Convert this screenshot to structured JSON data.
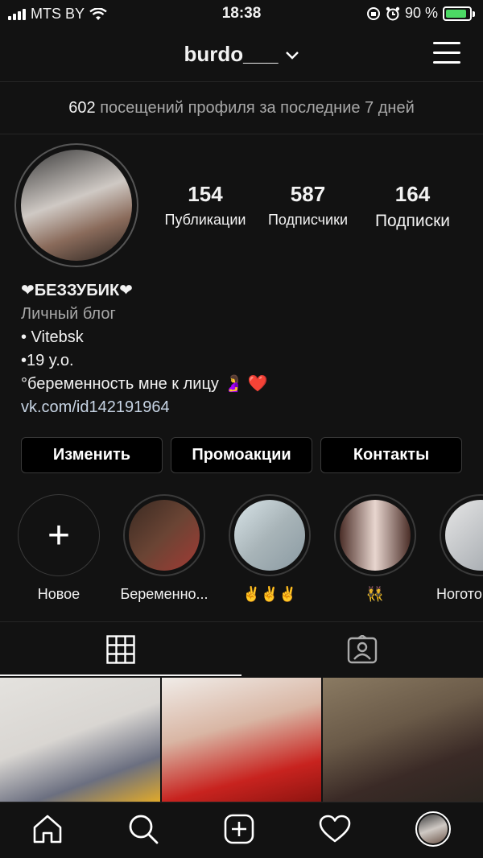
{
  "status_bar": {
    "carrier": "MTS BY",
    "time": "18:38",
    "battery_percent": "90 %",
    "battery_level": 0.9
  },
  "header": {
    "username": "burdo___"
  },
  "visits": {
    "count": "602",
    "text": "посещений профиля за последние 7 дней"
  },
  "stats": [
    {
      "value": "154",
      "label": "Публикации"
    },
    {
      "value": "587",
      "label": "Подписчики"
    },
    {
      "value": "164",
      "label": "Подписки"
    }
  ],
  "bio": {
    "name": "❤БЕЗЗУБИК❤",
    "category": "Личный блог",
    "line1": "• Vitebsk",
    "line2": "•19 y.o.",
    "line3": "°беременность мне к лицу 🤰 ❤️",
    "link": "vk.com/id142191964"
  },
  "buttons": {
    "edit": "Изменить",
    "promo": "Промоакции",
    "contacts": "Контакты"
  },
  "highlights": [
    {
      "label": "Новое",
      "icon": "plus-icon"
    },
    {
      "label": "Беременно...",
      "colors": [
        "#3a2a22",
        "#a23a34"
      ]
    },
    {
      "label": "✌️✌️✌️",
      "colors": [
        "#d8e4e8",
        "#8a9aa2"
      ]
    },
    {
      "label": "👯",
      "colors": [
        "#e8d6cf",
        "#4b2e28"
      ]
    },
    {
      "label": "Ногото",
      "colors": [
        "#e6e6e6",
        "#9aa0a6"
      ]
    }
  ],
  "tabs": {
    "grid_icon": "grid-icon",
    "tagged_icon": "tagged-person-icon"
  },
  "grid_posts": [
    {
      "colors": [
        "#d9d6d2",
        "#6b6f80"
      ]
    },
    {
      "colors": [
        "#e9e4e0",
        "#c8231f"
      ]
    },
    {
      "colors": [
        "#6a5a48",
        "#2b2520"
      ]
    }
  ],
  "bottom_nav": [
    "home-icon",
    "search-icon",
    "new-post-icon",
    "activity-heart-icon",
    "profile-avatar"
  ]
}
